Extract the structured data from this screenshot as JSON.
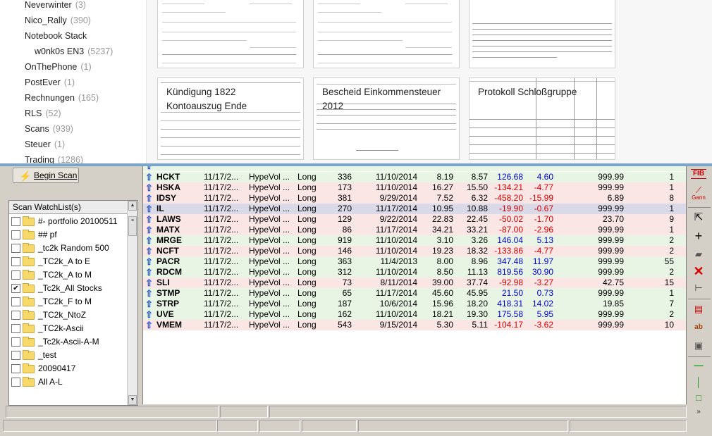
{
  "notebooks": [
    {
      "name": "Neverwinter",
      "count": "(3)",
      "indent": false
    },
    {
      "name": "Nico_Rally",
      "count": "(390)",
      "indent": false
    },
    {
      "name": "Notebook Stack",
      "count": "",
      "indent": false
    },
    {
      "name": "w0nk0s EN3",
      "count": "(5237)",
      "indent": true
    },
    {
      "name": "OnThePhone",
      "count": "(1)",
      "indent": false
    },
    {
      "name": "PostEver",
      "count": "(1)",
      "indent": false
    },
    {
      "name": "Rechnungen",
      "count": "(165)",
      "indent": false
    },
    {
      "name": "RLS",
      "count": "(52)",
      "indent": false
    },
    {
      "name": "Scans",
      "count": "(939)",
      "indent": false
    },
    {
      "name": "Steuer",
      "count": "(1)",
      "indent": false
    },
    {
      "name": "Trading",
      "count": "(1286)",
      "indent": false
    }
  ],
  "notes": [
    {
      "title_lines": [
        "Kündigung 1822",
        "Kontoauszug Ende"
      ]
    },
    {
      "title_lines": [
        "Bescheid Einkommensteuer",
        "2012"
      ]
    },
    {
      "title_lines": [
        "Protokoll Schloßgruppe"
      ]
    }
  ],
  "scan": {
    "begin_label": "Begin Scan",
    "watchlist_title": "Scan WatchList(s)"
  },
  "watchlists": [
    {
      "name": "#- portfolio 20100511",
      "checked": false
    },
    {
      "name": "## pf",
      "checked": false
    },
    {
      "name": "_tc2k Random 500",
      "checked": false
    },
    {
      "name": "_TC2k_A to E",
      "checked": false
    },
    {
      "name": "_TC2k_A to M",
      "checked": false
    },
    {
      "name": "_Tc2k_All Stocks",
      "checked": true
    },
    {
      "name": "_TC2k_F to M",
      "checked": false
    },
    {
      "name": "_TC2k_NtoZ",
      "checked": false
    },
    {
      "name": "_TC2k-Ascii",
      "checked": false
    },
    {
      "name": "_Tc2k-Ascii-A-M",
      "checked": false
    },
    {
      "name": "_test",
      "checked": false
    },
    {
      "name": "20090417",
      "checked": false
    },
    {
      "name": "All A-L",
      "checked": false
    }
  ],
  "rows": [
    {
      "symbol": "HCKT",
      "date": "11/17/2...",
      "scan": "HypeVol ...",
      "side": "Long",
      "c1": "336",
      "c2": "11/10/2014",
      "c3": "8.19",
      "c4": "8.57",
      "c5": "126.68",
      "c6": "4.60",
      "c7": "999.99",
      "c8": "1",
      "tone": "g",
      "neg": false
    },
    {
      "symbol": "HSKA",
      "date": "11/17/2...",
      "scan": "HypeVol ...",
      "side": "Long",
      "c1": "173",
      "c2": "11/10/2014",
      "c3": "16.27",
      "c4": "15.50",
      "c5": "-134.21",
      "c6": "-4.77",
      "c7": "999.99",
      "c8": "1",
      "tone": "r",
      "neg": true
    },
    {
      "symbol": "IDSY",
      "date": "11/17/2...",
      "scan": "HypeVol ...",
      "side": "Long",
      "c1": "381",
      "c2": "9/29/2014",
      "c3": "7.52",
      "c4": "6.32",
      "c5": "-458.20",
      "c6": "-15.99",
      "c7": "6.89",
      "c8": "8",
      "tone": "r",
      "neg": true
    },
    {
      "symbol": "IL",
      "date": "11/17/2...",
      "scan": "HypeVol ...",
      "side": "Long",
      "c1": "270",
      "c2": "11/17/2014",
      "c3": "10.95",
      "c4": "10.88",
      "c5": "-19.90",
      "c6": "-0.67",
      "c7": "999.99",
      "c8": "1",
      "tone": "s",
      "neg": true
    },
    {
      "symbol": "LAWS",
      "date": "11/17/2...",
      "scan": "HypeVol ...",
      "side": "Long",
      "c1": "129",
      "c2": "9/22/2014",
      "c3": "22.83",
      "c4": "22.45",
      "c5": "-50.02",
      "c6": "-1.70",
      "c7": "23.70",
      "c8": "9",
      "tone": "r",
      "neg": true
    },
    {
      "symbol": "MATX",
      "date": "11/17/2...",
      "scan": "HypeVol ...",
      "side": "Long",
      "c1": "86",
      "c2": "11/17/2014",
      "c3": "34.21",
      "c4": "33.21",
      "c5": "-87.00",
      "c6": "-2.96",
      "c7": "999.99",
      "c8": "1",
      "tone": "r",
      "neg": true
    },
    {
      "symbol": "MRGE",
      "date": "11/17/2...",
      "scan": "HypeVol ...",
      "side": "Long",
      "c1": "919",
      "c2": "11/10/2014",
      "c3": "3.10",
      "c4": "3.26",
      "c5": "146.04",
      "c6": "5.13",
      "c7": "999.99",
      "c8": "2",
      "tone": "g",
      "neg": false
    },
    {
      "symbol": "NCFT",
      "date": "11/17/2...",
      "scan": "HypeVol ...",
      "side": "Long",
      "c1": "146",
      "c2": "11/10/2014",
      "c3": "19.23",
      "c4": "18.32",
      "c5": "-133.86",
      "c6": "-4.77",
      "c7": "999.99",
      "c8": "2",
      "tone": "r",
      "neg": true
    },
    {
      "symbol": "PACR",
      "date": "11/17/2...",
      "scan": "HypeVol ...",
      "side": "Long",
      "c1": "363",
      "c2": "11/4/2013",
      "c3": "8.00",
      "c4": "8.96",
      "c5": "347.48",
      "c6": "11.97",
      "c7": "999.99",
      "c8": "55",
      "tone": "g",
      "neg": false
    },
    {
      "symbol": "RDCM",
      "date": "11/17/2...",
      "scan": "HypeVol ...",
      "side": "Long",
      "c1": "312",
      "c2": "11/10/2014",
      "c3": "8.50",
      "c4": "11.13",
      "c5": "819.56",
      "c6": "30.90",
      "c7": "999.99",
      "c8": "2",
      "tone": "g",
      "neg": false
    },
    {
      "symbol": "SLI",
      "date": "11/17/2...",
      "scan": "HypeVol ...",
      "side": "Long",
      "c1": "73",
      "c2": "8/11/2014",
      "c3": "39.00",
      "c4": "37.74",
      "c5": "-92.98",
      "c6": "-3.27",
      "c7": "42.75",
      "c8": "15",
      "tone": "r",
      "neg": true
    },
    {
      "symbol": "STMP",
      "date": "11/17/2...",
      "scan": "HypeVol ...",
      "side": "Long",
      "c1": "65",
      "c2": "11/17/2014",
      "c3": "45.60",
      "c4": "45.95",
      "c5": "21.50",
      "c6": "0.73",
      "c7": "999.99",
      "c8": "1",
      "tone": "g",
      "neg": false
    },
    {
      "symbol": "STRP",
      "date": "11/17/2...",
      "scan": "HypeVol ...",
      "side": "Long",
      "c1": "187",
      "c2": "10/6/2014",
      "c3": "15.96",
      "c4": "18.20",
      "c5": "418.31",
      "c6": "14.02",
      "c7": "19.85",
      "c8": "7",
      "tone": "g",
      "neg": false
    },
    {
      "symbol": "UVE",
      "date": "11/17/2...",
      "scan": "HypeVol ...",
      "side": "Long",
      "c1": "162",
      "c2": "11/10/2014",
      "c3": "18.21",
      "c4": "19.30",
      "c5": "175.58",
      "c6": "5.95",
      "c7": "999.99",
      "c8": "2",
      "tone": "g",
      "neg": false
    },
    {
      "symbol": "VMEM",
      "date": "11/17/2...",
      "scan": "HypeVol ...",
      "side": "Long",
      "c1": "543",
      "c2": "9/15/2014",
      "c3": "5.30",
      "c4": "5.11",
      "c5": "-104.17",
      "c6": "-3.62",
      "c7": "999.99",
      "c8": "10",
      "tone": "r",
      "neg": true
    }
  ],
  "toolbar": {
    "fib_label": "FIB",
    "gann_label": "Gann"
  },
  "colors": {
    "accent_blue": "#1e4fd6",
    "gain_bg": "#e8f5e4",
    "loss_bg": "#fbe6e6",
    "neg_text": "#d40000",
    "pos_text": "#0000cc"
  }
}
